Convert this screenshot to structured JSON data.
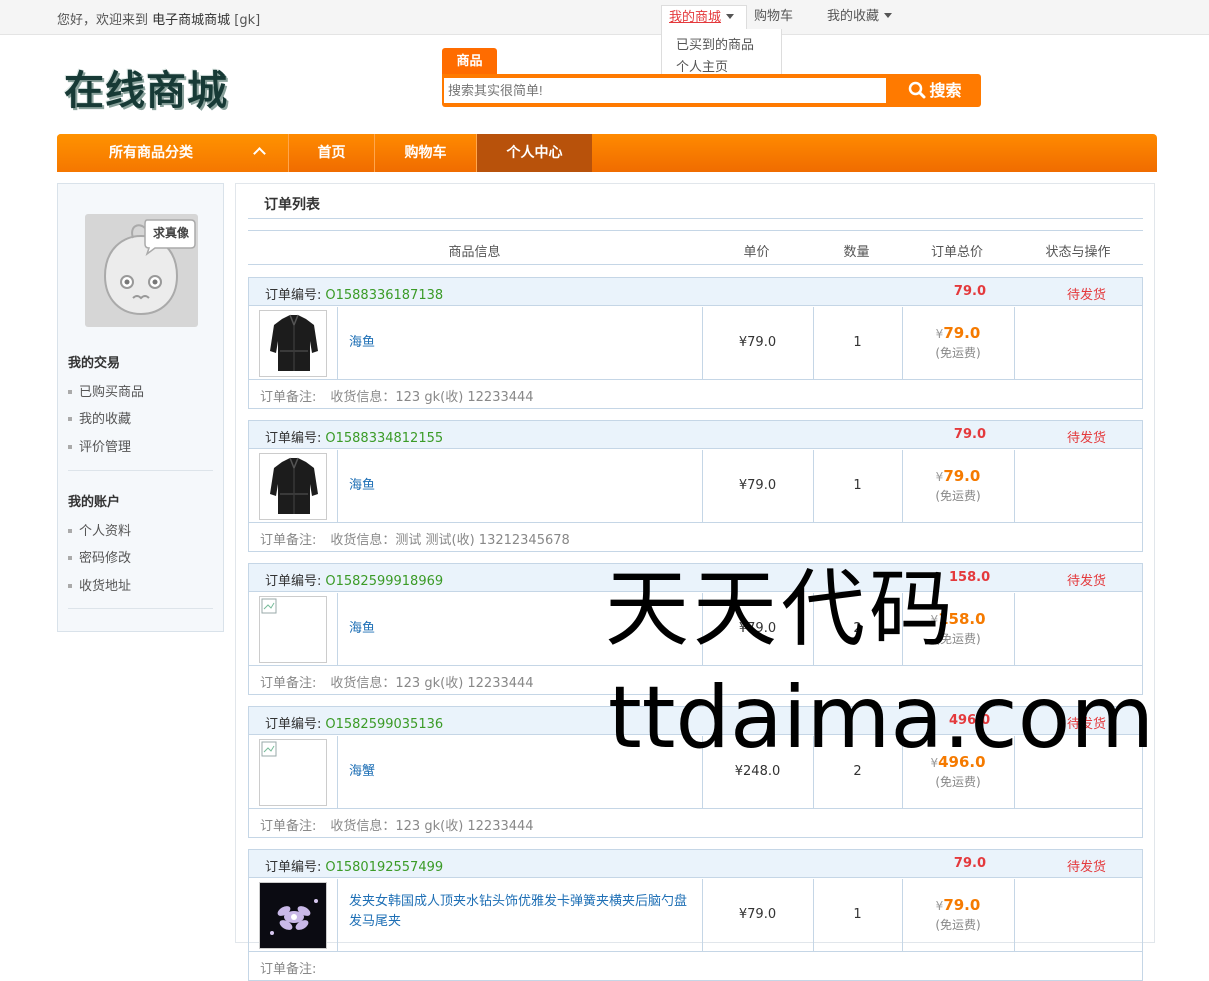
{
  "topbar": {
    "welcome_prefix": "您好，欢迎来到 ",
    "site_name": "电子商城商城",
    "user": "[gk]",
    "my_mall": "我的商城",
    "cart": "购物车",
    "favorites": "我的收藏",
    "dropdown": [
      "已买到的商品",
      "个人主页"
    ]
  },
  "header": {
    "logo_text": "在线商城",
    "search_tab": "商品",
    "search_placeholder": "搜索其实很简单!",
    "search_button": "搜索"
  },
  "nav": {
    "all_categories": "所有商品分类",
    "items": [
      "首页",
      "购物车",
      "个人中心"
    ]
  },
  "sidebar": {
    "avatar_text": "求真像",
    "section1_title": "我的交易",
    "section1_items": [
      "已购买商品",
      "我的收藏",
      "评价管理"
    ],
    "section2_title": "我的账户",
    "section2_items": [
      "个人资料",
      "密码修改",
      "收货地址"
    ]
  },
  "content": {
    "title": "订单列表",
    "columns": [
      "商品信息",
      "单价",
      "数量",
      "订单总价",
      "状态与操作"
    ],
    "order_no_label": "订单编号:",
    "note_label": "订单备注:",
    "currency": "¥",
    "shipping_note": "(免运费)",
    "orders": [
      {
        "no": "O1588336187138",
        "total": "79.0",
        "status": "待发货",
        "product": "海鱼",
        "price": "¥79.0",
        "qty": "1",
        "line_total": "79.0",
        "shipping": "收货信息：123 gk(收) 12233444",
        "image": "jacket"
      },
      {
        "no": "O1588334812155",
        "total": "79.0",
        "status": "待发货",
        "product": "海鱼",
        "price": "¥79.0",
        "qty": "1",
        "line_total": "79.0",
        "shipping": "收货信息：测试 测试(收) 13212345678",
        "image": "jacket"
      },
      {
        "no": "O1582599918969",
        "total": "158.0",
        "status": "待发货",
        "product": "海鱼",
        "price": "¥79.0",
        "qty": "2",
        "line_total": "158.0",
        "shipping": "收货信息：123 gk(收) 12233444",
        "image": "broken"
      },
      {
        "no": "O1582599035136",
        "total": "496.0",
        "status": "待发货",
        "product": "海蟹",
        "price": "¥248.0",
        "qty": "2",
        "line_total": "496.0",
        "shipping": "收货信息：123 gk(收) 12233444",
        "image": "broken"
      },
      {
        "no": "O1580192557499",
        "total": "79.0",
        "status": "待发货",
        "product": "发夹女韩国成人顶夹水钻头饰优雅发卡弹簧夹横夹后脑勺盘发马尾夹",
        "price": "¥79.0",
        "qty": "1",
        "line_total": "79.0",
        "shipping": "",
        "image": "hairclip"
      }
    ]
  },
  "watermark": {
    "line1": "天天代码",
    "line2": "ttdaima.com"
  }
}
